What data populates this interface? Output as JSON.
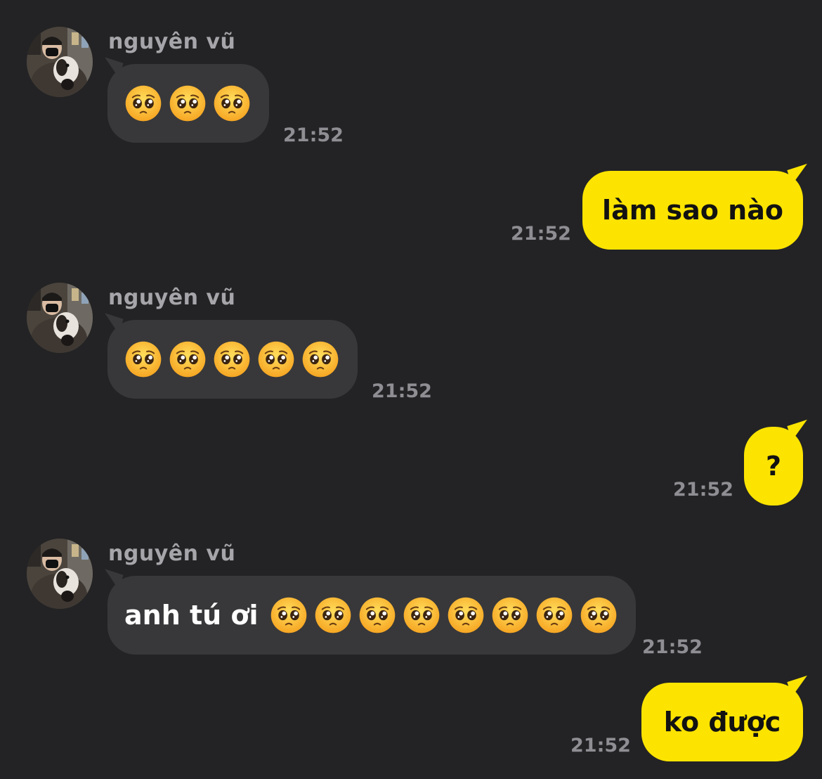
{
  "colors": {
    "background": "#232325",
    "incoming_bubble": "#38383a",
    "outgoing_bubble": "#fde400",
    "sender_name": "#a6a6aa",
    "timestamp": "#8e8e93"
  },
  "messages": [
    {
      "direction": "incoming",
      "sender": "nguyên vũ",
      "avatar": "profile-photo",
      "text": "",
      "emoji": "pleading-face",
      "emoji_count": 3,
      "time": "21:52"
    },
    {
      "direction": "outgoing",
      "text": "làm sao nào",
      "time": "21:52"
    },
    {
      "direction": "incoming",
      "sender": "nguyên vũ",
      "avatar": "profile-photo",
      "text": "",
      "emoji": "pleading-face",
      "emoji_count": 5,
      "time": "21:52"
    },
    {
      "direction": "outgoing",
      "text": "?",
      "time": "21:52"
    },
    {
      "direction": "incoming",
      "sender": "nguyên vũ",
      "avatar": "profile-photo",
      "text": "anh tú ơi",
      "emoji": "pleading-face",
      "emoji_count": 8,
      "time": "21:52"
    },
    {
      "direction": "outgoing",
      "text": "ko được",
      "time": "21:52"
    }
  ]
}
